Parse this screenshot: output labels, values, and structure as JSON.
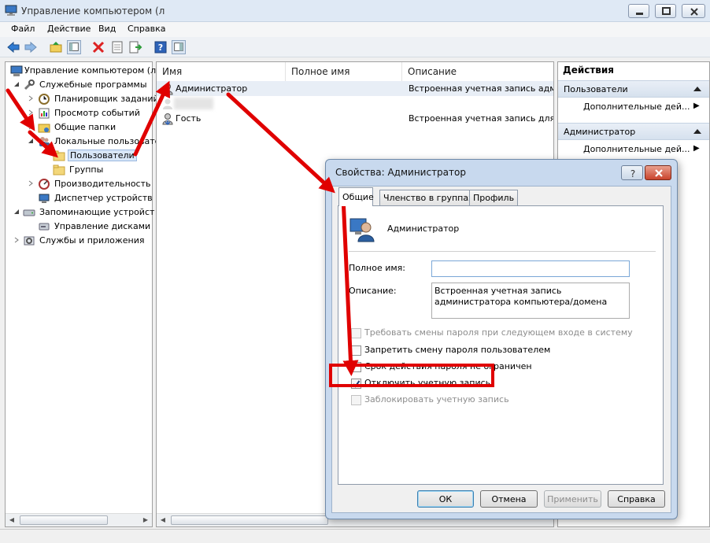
{
  "window": {
    "title": "Управление компьютером (л",
    "app_icon": "computer-management-icon"
  },
  "menu": [
    "Файл",
    "Действие",
    "Вид",
    "Справка"
  ],
  "toolbar": {
    "icons": [
      "back-arrow-icon",
      "forward-arrow-icon",
      "up-folder-icon",
      "show-hide-tree-icon",
      "delete-icon",
      "properties-icon",
      "export-icon",
      "help-icon",
      "show-hide-action-pane-icon"
    ]
  },
  "tree": {
    "items": [
      {
        "label": "Управление компьютером (л",
        "icon": "computer-management-icon"
      },
      {
        "label": "Служебные программы",
        "icon": "tools-icon"
      },
      {
        "label": "Планировщик заданий",
        "icon": "task-scheduler-icon"
      },
      {
        "label": "Просмотр событий",
        "icon": "event-viewer-icon"
      },
      {
        "label": "Общие папки",
        "icon": "shared-folders-icon"
      },
      {
        "label": "Локальные пользователи",
        "icon": "local-users-icon"
      },
      {
        "label": "Пользователи",
        "icon": "folder-icon"
      },
      {
        "label": "Группы",
        "icon": "folder-icon"
      },
      {
        "label": "Производительность",
        "icon": "performance-icon"
      },
      {
        "label": "Диспетчер устройств",
        "icon": "device-manager-icon"
      },
      {
        "label": "Запоминающие устройст",
        "icon": "storage-icon"
      },
      {
        "label": "Управление дисками",
        "icon": "disk-management-icon"
      },
      {
        "label": "Службы и приложения",
        "icon": "services-icon"
      }
    ]
  },
  "list": {
    "columns": [
      "Имя",
      "Полное имя",
      "Описание"
    ],
    "rows": [
      {
        "name": "Администратор",
        "full_name": "",
        "description": "Встроенная учетная запись адм..."
      },
      {
        "name": "",
        "full_name": "",
        "description": ""
      },
      {
        "name": "Гость",
        "full_name": "",
        "description": "Встроенная учетная запись для ..."
      }
    ]
  },
  "actions": {
    "header": "Действия",
    "sections": [
      {
        "title": "Пользователи",
        "item": "Дополнительные дей..."
      },
      {
        "title": "Администратор",
        "item": "Дополнительные дей..."
      }
    ]
  },
  "dialog": {
    "title": "Свойства: Администратор",
    "tabs": [
      "Общие",
      "Членство в группах",
      "Профиль"
    ],
    "account_name": "Администратор",
    "full_name_label": "Полное имя:",
    "full_name_value": "",
    "description_label": "Описание:",
    "description_value": "Встроенная учетная запись администратора компьютера/домена",
    "checkboxes": [
      {
        "label": "Требовать смены пароля при следующем входе в систему",
        "checked": false,
        "enabled": false
      },
      {
        "label": "Запретить смену пароля пользователем",
        "checked": false,
        "enabled": true
      },
      {
        "label": "Срок действия пароля не ограничен",
        "checked": false,
        "enabled": true
      },
      {
        "label": "Отключить учетную запись",
        "checked": true,
        "enabled": true
      },
      {
        "label": "Заблокировать учетную запись",
        "checked": false,
        "enabled": false
      }
    ],
    "buttons": {
      "ok": "ОК",
      "cancel": "Отмена",
      "apply": "Применить",
      "help": "Справка"
    }
  },
  "colors": {
    "annotation_red": "#e00000",
    "selection": "#d9e7f8"
  }
}
